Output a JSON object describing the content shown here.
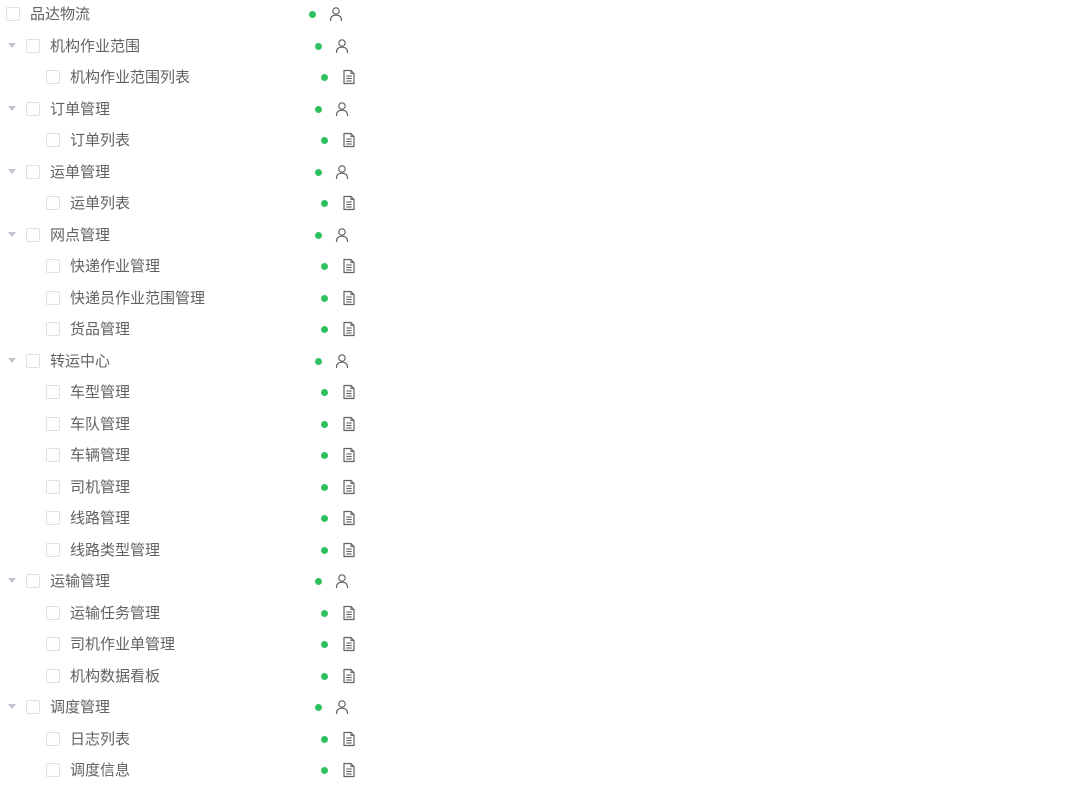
{
  "colors": {
    "status_dot": "#2fc15f",
    "icon": "#606266",
    "checkbox_border": "#dcdfe6",
    "arrow": "#c0c4cc",
    "text": "#606266"
  },
  "tree": {
    "root": {
      "label": "品达物流",
      "icon": "user-icon",
      "status": "enabled"
    },
    "groups": [
      {
        "label": "机构作业范围",
        "icon": "user-icon",
        "expanded": true,
        "children": [
          {
            "label": "机构作业范围列表",
            "icon": "document-icon"
          }
        ]
      },
      {
        "label": "订单管理",
        "icon": "user-icon",
        "expanded": true,
        "children": [
          {
            "label": "订单列表",
            "icon": "document-icon"
          }
        ]
      },
      {
        "label": "运单管理",
        "icon": "user-icon",
        "expanded": true,
        "children": [
          {
            "label": "运单列表",
            "icon": "document-icon"
          }
        ]
      },
      {
        "label": "网点管理",
        "icon": "user-icon",
        "expanded": true,
        "children": [
          {
            "label": "快递作业管理",
            "icon": "document-icon"
          },
          {
            "label": "快递员作业范围管理",
            "icon": "document-icon"
          },
          {
            "label": "货品管理",
            "icon": "document-icon"
          }
        ]
      },
      {
        "label": "转运中心",
        "icon": "user-icon",
        "expanded": true,
        "children": [
          {
            "label": "车型管理",
            "icon": "document-icon"
          },
          {
            "label": "车队管理",
            "icon": "document-icon"
          },
          {
            "label": "车辆管理",
            "icon": "document-icon"
          },
          {
            "label": "司机管理",
            "icon": "document-icon"
          },
          {
            "label": "线路管理",
            "icon": "document-icon"
          },
          {
            "label": "线路类型管理",
            "icon": "document-icon"
          }
        ]
      },
      {
        "label": "运输管理",
        "icon": "user-icon",
        "expanded": true,
        "children": [
          {
            "label": "运输任务管理",
            "icon": "document-icon"
          },
          {
            "label": "司机作业单管理",
            "icon": "document-icon"
          },
          {
            "label": "机构数据看板",
            "icon": "document-icon"
          }
        ]
      },
      {
        "label": "调度管理",
        "icon": "user-icon",
        "expanded": true,
        "children": [
          {
            "label": "日志列表",
            "icon": "document-icon"
          },
          {
            "label": "调度信息",
            "icon": "document-icon"
          }
        ]
      }
    ]
  }
}
